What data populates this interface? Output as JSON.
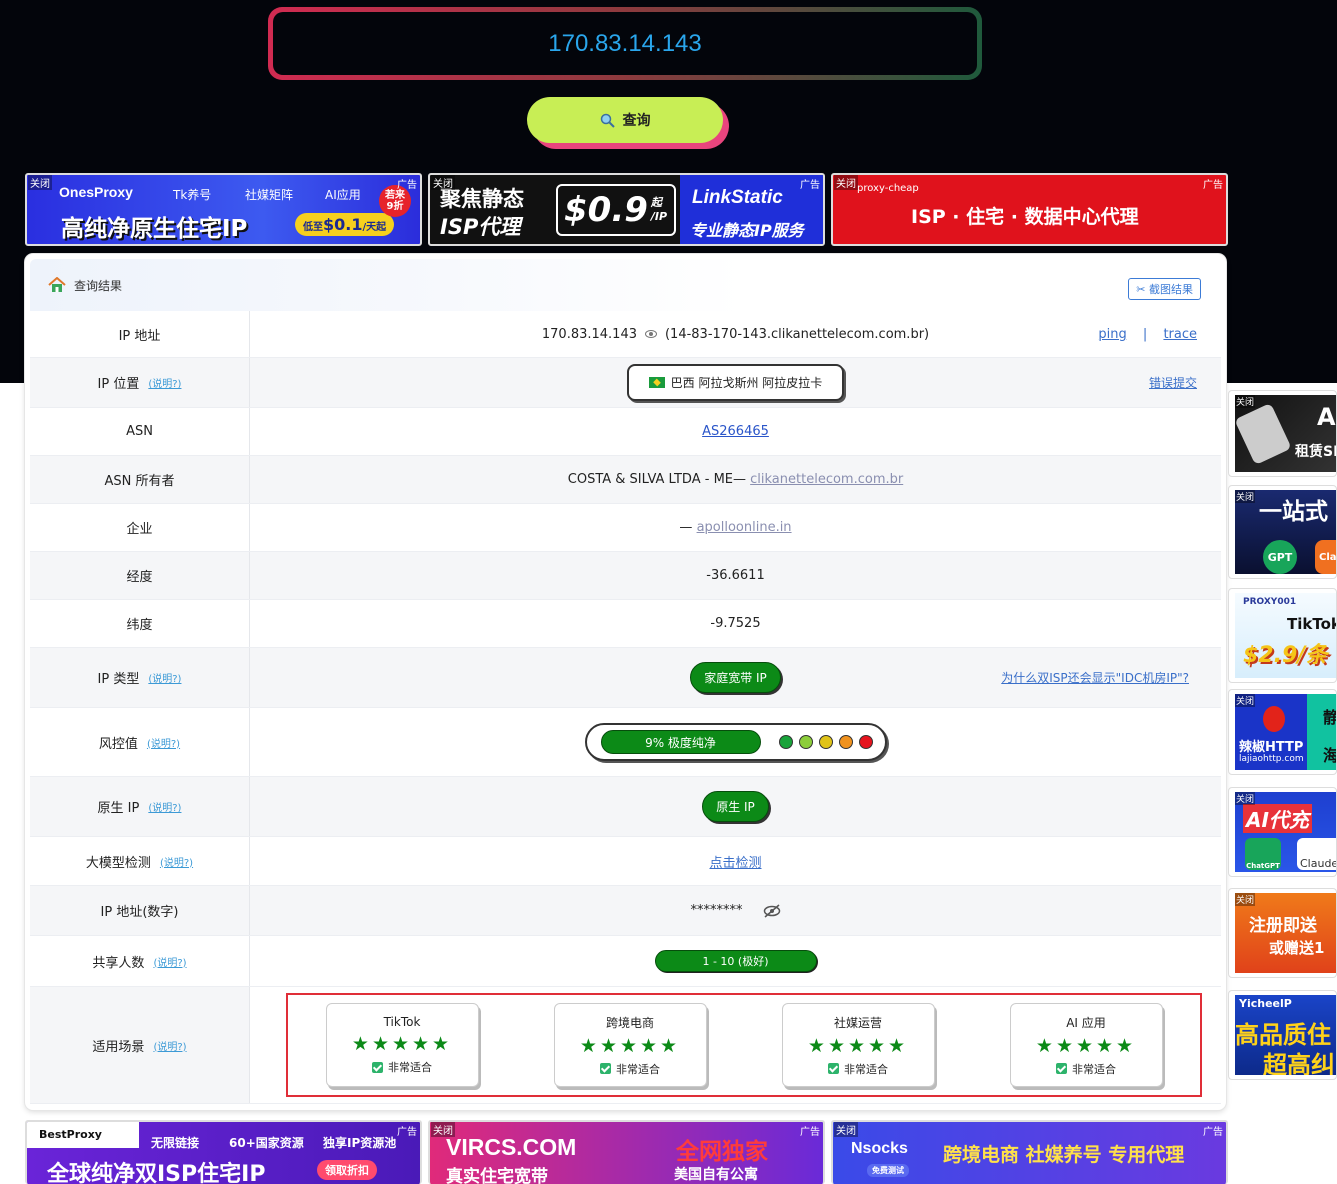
{
  "search": {
    "value": "170.83.14.143"
  },
  "query_button": {
    "label": "查询"
  },
  "common": {
    "close": "关闭",
    "ad_tag": "广告"
  },
  "top_ads": [
    {
      "brand": "OnesProxy",
      "tags": [
        "Tk养号",
        "社媒矩阵",
        "AI应用"
      ],
      "headline": "高纯净原生住宅IP",
      "price_prefix": "低至",
      "price": "$0.1",
      "price_unit": "/天起",
      "badge_lines": [
        "若来",
        "9折"
      ]
    },
    {
      "headline_1": "聚焦静态",
      "headline_2": "ISP代理",
      "price": "$0.9",
      "price_unit_top": "起",
      "price_unit_bottom": "/IP",
      "brand": "LinkStatic",
      "slogan": "专业静态IP服务"
    },
    {
      "brand": "proxy-cheap",
      "headline": "ISP · 住宅 · 数据中心代理"
    }
  ],
  "result": {
    "title": "查询结果",
    "screenshot_button": "截图结果",
    "help": "(说明?)",
    "rows": {
      "ip": {
        "label": "IP 地址",
        "value": "170.83.14.143",
        "host": "(14-83-170-143.clikanettelecom.com.br)",
        "ping": "ping",
        "separator": "|",
        "trace": "trace"
      },
      "location": {
        "label": "IP 位置",
        "value": "巴西 阿拉戈斯州 阿拉皮拉卡",
        "report": "错误提交"
      },
      "asn": {
        "label": "ASN",
        "value": "AS266465"
      },
      "asn_owner": {
        "label": "ASN 所有者",
        "value": "COSTA & SILVA LTDA - ME—",
        "link": "clikanettelecom.com.br"
      },
      "company": {
        "label": "企业",
        "prefix": "—",
        "link": "apolloonline.in"
      },
      "longitude": {
        "label": "经度",
        "value": "-36.6611"
      },
      "latitude": {
        "label": "纬度",
        "value": "-9.7525"
      },
      "ip_type": {
        "label": "IP 类型",
        "value": "家庭宽带 IP",
        "note": "为什么双ISP还会显示\"IDC机房IP\"?"
      },
      "risk": {
        "label": "风控值",
        "value": "9%  极度纯净",
        "percent": 9
      },
      "native": {
        "label": "原生 IP",
        "value": "原生 IP"
      },
      "llm": {
        "label": "大模型检测",
        "value": "点击检测"
      },
      "ip_numeric": {
        "label": "IP 地址(数字)",
        "value": "********"
      },
      "shared": {
        "label": "共享人数",
        "value": "1 - 10 (极好)"
      },
      "scenes": {
        "label": "适用场景",
        "items": [
          {
            "name": "TikTok",
            "stars": "★★★★★",
            "verdict": "非常适合"
          },
          {
            "name": "跨境电商",
            "stars": "★★★★★",
            "verdict": "非常适合"
          },
          {
            "name": "社媒运营",
            "stars": "★★★★★",
            "verdict": "非常适合"
          },
          {
            "name": "AI 应用",
            "stars": "★★★★★",
            "verdict": "非常适合"
          }
        ]
      }
    }
  },
  "colors": {
    "risk_dots": [
      "#19a33a",
      "#8ccd3a",
      "#e0c318",
      "#f0921e",
      "#e6141e"
    ],
    "accent_green": "#0c8a17"
  },
  "side_ads": [
    {
      "text_1": "A",
      "text_2": "租赁SI"
    },
    {
      "text_1": "一站式",
      "text_2": "GPT",
      "text_3": "Clau"
    },
    {
      "text_1": "PROXY001",
      "text_2": "TikTok",
      "text_3": "$2.9/条"
    },
    {
      "text_1": "辣椒HTTP",
      "text_2": "lajiaohttp.com",
      "text_3": "静",
      "text_4": "海"
    },
    {
      "text_1": "AI代充",
      "text_2": "ChatGPT",
      "text_3": "Claude"
    },
    {
      "text_1": "注册即送",
      "text_2": "或赠送1"
    },
    {
      "text_1": "YicheelP",
      "text_2": "高品质住",
      "text_3": "超高纠"
    }
  ],
  "bottom_ads": [
    {
      "brand": "BestProxy",
      "tags": [
        "无限链接",
        "60+国家资源",
        "独享IP资源池"
      ],
      "headline": "全球纯净双ISP住宅IP",
      "cta": "领取折扣"
    },
    {
      "brand": "VIRCS.COM",
      "headline": "全网独家",
      "sub_1": "真实住宅宽带",
      "sub_2": "美国自有公寓"
    },
    {
      "brand": "Nsocks",
      "badge": "免费测试",
      "headline": "跨境电商 社媒养号 专用代理"
    }
  ]
}
